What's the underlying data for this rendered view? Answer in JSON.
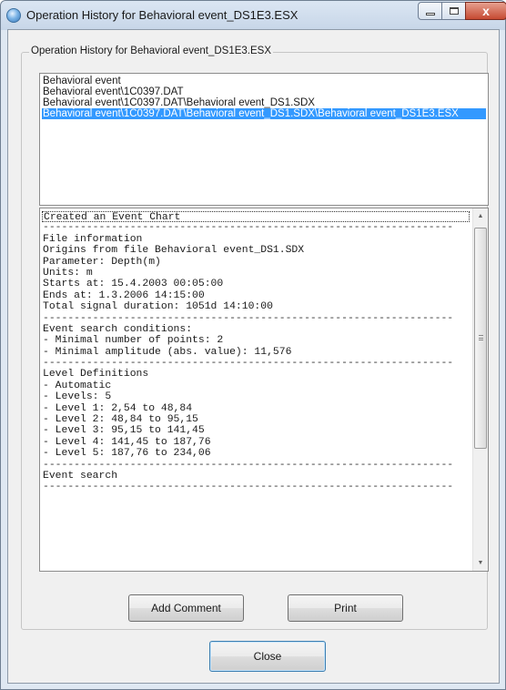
{
  "window": {
    "title": "Operation History for Behavioral event_DS1E3.ESX",
    "buttons": {
      "minimize": "minimize-icon",
      "maximize": "maximize-icon",
      "close": "x"
    }
  },
  "group": {
    "label": "Operation History for Behavioral event_DS1E3.ESX"
  },
  "history": {
    "items": [
      "Behavioral event",
      "Behavioral event\\1C0397.DAT",
      "Behavioral event\\1C0397.DAT\\Behavioral event_DS1.SDX",
      "Behavioral event\\1C0397.DAT\\Behavioral event_DS1.SDX\\Behavioral event_DS1E3.ESX"
    ],
    "selected_index": 3
  },
  "log": {
    "lines": [
      "Created an Event Chart",
      "------------------------------------------------------------------",
      "File information",
      "Origins from file Behavioral event_DS1.SDX",
      "Parameter: Depth(m)",
      "Units: m",
      "Starts at: 15.4.2003 00:05:00",
      "Ends at: 1.3.2006 14:15:00",
      "Total signal duration: 1051d 14:10:00",
      "------------------------------------------------------------------",
      "Event search conditions:",
      "- Minimal number of points: 2",
      "- Minimal amplitude (abs. value): 11,576",
      "------------------------------------------------------------------",
      "Level Definitions",
      "- Automatic",
      "- Levels: 5",
      "- Level 1: 2,54 to 48,84",
      "- Level 2: 48,84 to 95,15",
      "- Level 3: 95,15 to 141,45",
      "- Level 4: 141,45 to 187,76",
      "- Level 5: 187,76 to 234,06",
      "------------------------------------------------------------------",
      "Event search",
      "------------------------------------------------------------------"
    ]
  },
  "buttons": {
    "add_comment": "Add Comment",
    "print": "Print",
    "close": "Close"
  },
  "colors": {
    "selection": "#3399ff",
    "close_button": "#c54a32",
    "dialog_bg": "#f0f0f0"
  }
}
